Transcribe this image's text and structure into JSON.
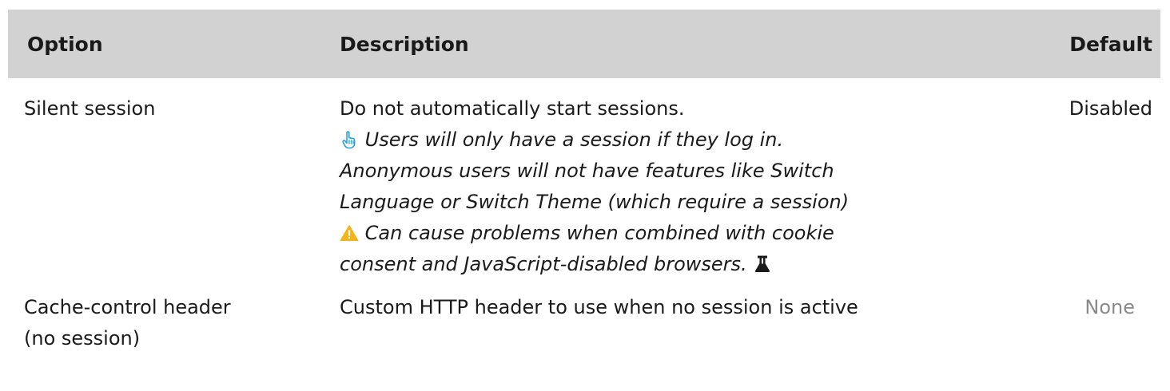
{
  "header": {
    "option": "Option",
    "description": "Description",
    "default": "Default"
  },
  "rows": [
    {
      "option": "Silent session",
      "description": "Do not automatically start sessions.",
      "notes": [
        {
          "icon": "hand-pointer-icon",
          "lines": [
            "Users will only have a session if they log in.",
            "Anonymous users will not have features like Switch",
            "Language or Switch Theme (which require a session)"
          ]
        },
        {
          "icon": "warning-icon",
          "lines": [
            "Can cause problems when combined with cookie",
            "consent and JavaScript-disabled browsers."
          ],
          "trailing_icon": "flask-icon"
        }
      ],
      "default": "Disabled"
    },
    {
      "option_lines": [
        "Cache-control header",
        "(no session)"
      ],
      "description": "Custom HTTP header to use when no session is active",
      "default": "None"
    }
  ],
  "colors": {
    "header_bg": "#d2d2d2",
    "hand_icon": "#29a3d9",
    "warning_icon": "#f2b51d",
    "muted_default": "#8a8a8a"
  }
}
